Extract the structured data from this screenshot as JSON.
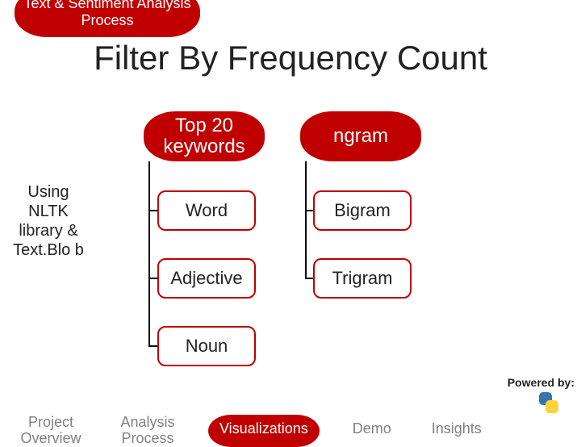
{
  "header_badge": "Text & Sentiment Analysis Process",
  "title": "Filter By Frequency Count",
  "sidebar": {
    "text": "Using NLTK library & Text.Blo b"
  },
  "branches": {
    "left": {
      "header": "Top 20 keywords",
      "items": [
        "Word",
        "Adjective",
        "Noun"
      ]
    },
    "right": {
      "header": "ngram",
      "items": [
        "Bigram",
        "Trigram"
      ]
    }
  },
  "powered_by": "Powered by:",
  "logo_name": "python-logo",
  "nav": {
    "items": [
      {
        "label": "Project Overview",
        "active": false
      },
      {
        "label": "Analysis Process",
        "active": false
      },
      {
        "label": "Visualizations",
        "active": true
      },
      {
        "label": "Demo",
        "active": false
      },
      {
        "label": "Insights",
        "active": false
      }
    ]
  }
}
